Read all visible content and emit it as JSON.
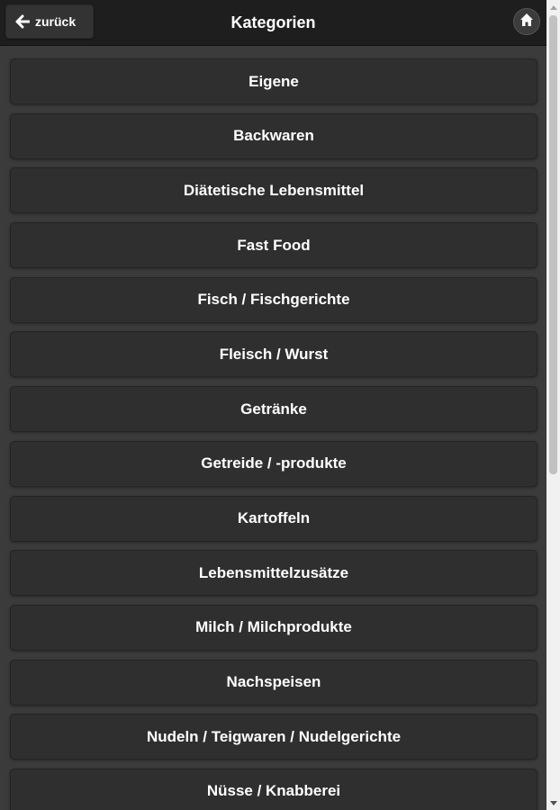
{
  "header": {
    "back_label": "zurück",
    "title": "Kategorien",
    "back_icon": "arrow-left-icon",
    "home_icon": "home-icon"
  },
  "categories": [
    "Eigene",
    "Backwaren",
    "Diätetische Lebensmittel",
    "Fast Food",
    "Fisch / Fischgerichte",
    "Fleisch / Wurst",
    "Getränke",
    "Getreide / -produkte",
    "Kartoffeln",
    "Lebensmittelzusätze",
    "Milch / Milchprodukte",
    "Nachspeisen",
    "Nudeln / Teigwaren / Nudelgerichte",
    "Nüsse / Knabberei"
  ],
  "colors": {
    "background": "#3b3b3b",
    "header": "#1e1e1e",
    "item": "#2f2f2f",
    "text": "#ffffff"
  }
}
